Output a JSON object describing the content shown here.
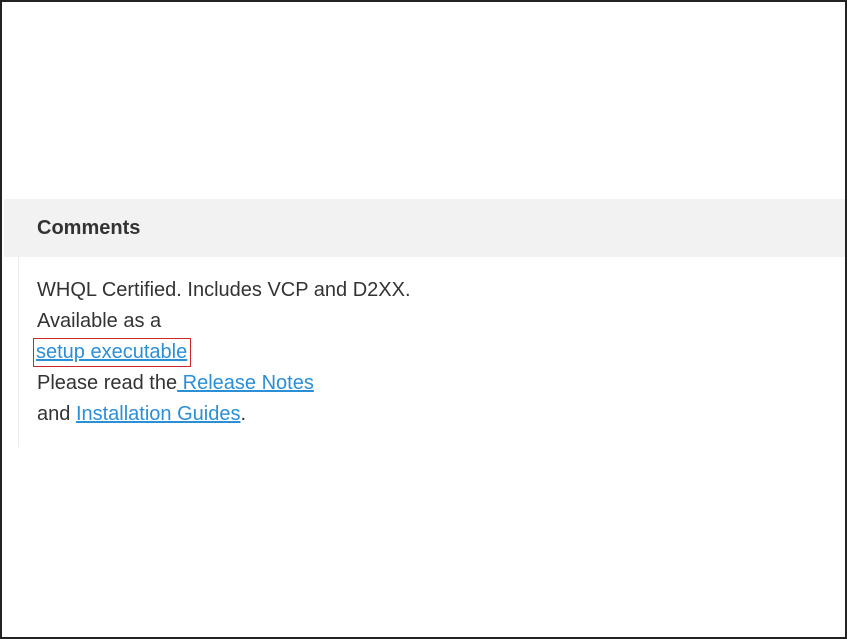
{
  "comments": {
    "title": "Comments",
    "line1": "WHQL Certified. Includes VCP and D2XX.",
    "line2": "Available as a",
    "setup_link": "setup executable",
    "line4_prefix": "Please read the",
    "release_notes_link": " Release Notes",
    "line5_prefix": "and ",
    "installation_guides_link": "Installation Guides",
    "line5_suffix": "."
  },
  "colors": {
    "link": "#2b8fd6",
    "highlight_border": "#d0252b",
    "header_background": "#f2f2f2",
    "text": "#333333"
  }
}
